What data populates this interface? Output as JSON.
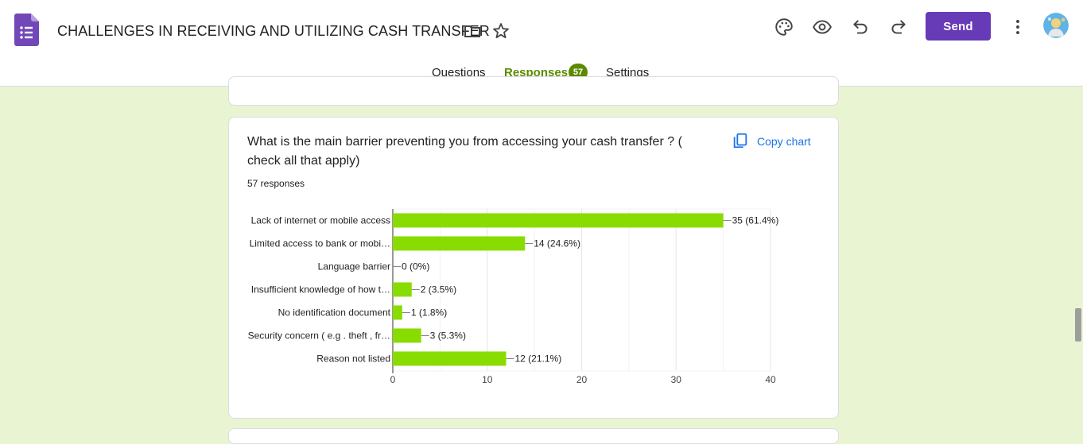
{
  "header": {
    "title": "CHALLENGES IN RECEIVING AND UTILIZING CASH TRANSFER",
    "send_label": "Send",
    "icons": [
      "forms-logo",
      "folder-icon",
      "star-icon",
      "palette-icon",
      "eye-icon",
      "undo-icon",
      "redo-icon",
      "more-vert-icon",
      "avatar"
    ]
  },
  "tabs": [
    {
      "label": "Questions",
      "active": false
    },
    {
      "label": "Responses",
      "active": true,
      "badge": "57"
    },
    {
      "label": "Settings",
      "active": false
    }
  ],
  "card": {
    "question": "What is the main barrier preventing you from accessing your cash transfer ? ( check all that apply)",
    "responses": "57 responses",
    "copy_label": "Copy chart"
  },
  "colors": {
    "accent": "#5b8a00",
    "bar": "#88dc00",
    "brand": "#673ab7",
    "link": "#1a73e8",
    "background": "#e9f5d2"
  },
  "chart_data": {
    "type": "bar",
    "orientation": "horizontal",
    "categories": [
      "Lack of internet or mobile access",
      "Limited access to bank or mobi…",
      "Language barrier",
      "Insufficient knowledge of how t…",
      "No identification document",
      "Security concern ( e.g . theft , fr…",
      "Reason not listed"
    ],
    "values": [
      35,
      14,
      0,
      2,
      1,
      3,
      12
    ],
    "labels": [
      "35 (61.4%)",
      "14 (24.6%)",
      "0 (0%)",
      "2 (3.5%)",
      "1 (1.8%)",
      "3 (5.3%)",
      "12 (21.1%)"
    ],
    "xticks": [
      "0",
      "10",
      "20",
      "30",
      "40"
    ],
    "xlim": [
      0,
      40
    ],
    "grid": true
  }
}
